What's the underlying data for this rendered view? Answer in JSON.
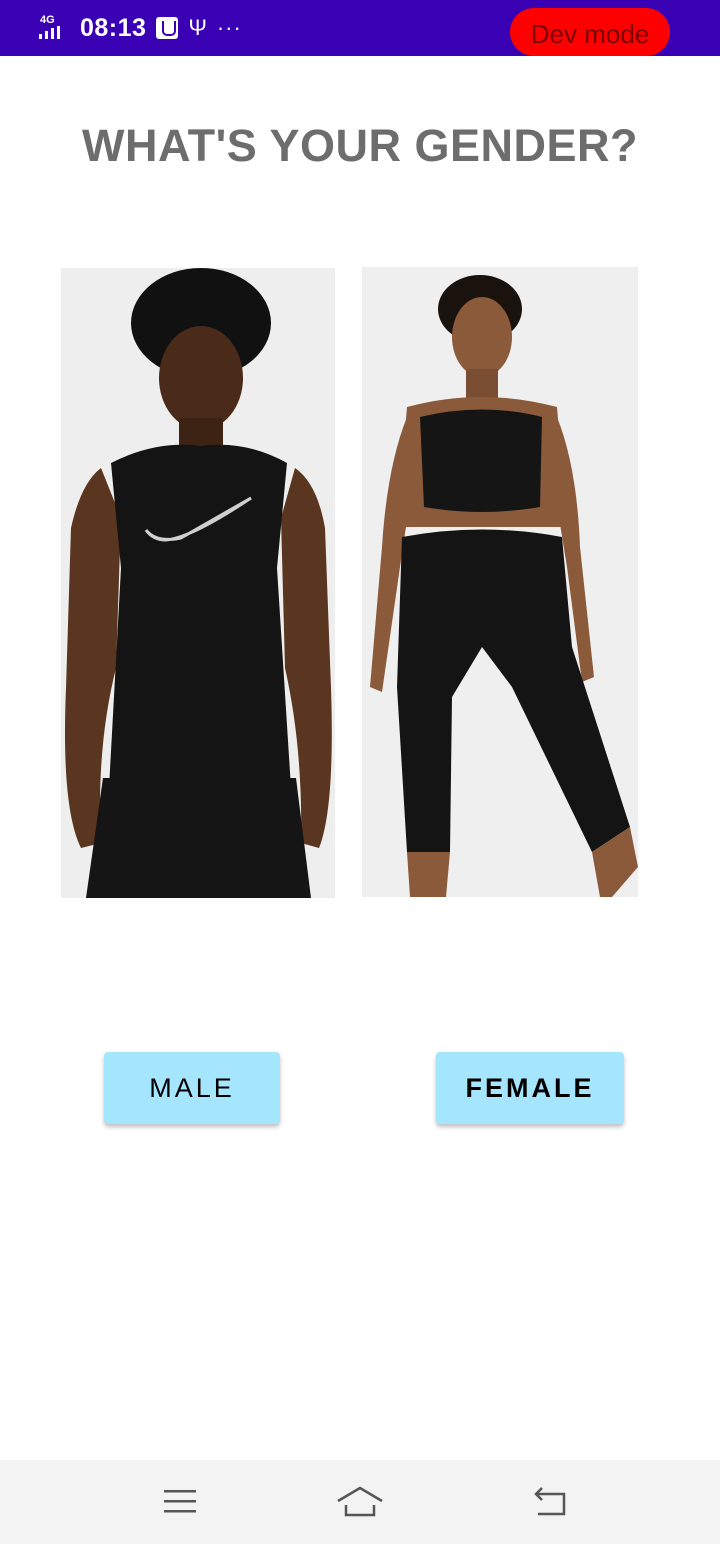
{
  "status_bar": {
    "network": "4G",
    "time": "08:13",
    "more": "···"
  },
  "dev_mode": {
    "label": "Dev mode",
    "color": "#ff0000"
  },
  "page": {
    "title": "WHAT'S YOUR GENDER?",
    "options": [
      {
        "image": "man-in-black-sleeveless-top-photo",
        "label": "MALE"
      },
      {
        "image": "woman-in-black-sports-bra-and-leggings-photo",
        "label": "FEMALE"
      }
    ]
  },
  "colors": {
    "status_bar": "#3a00b4",
    "title": "#6d6d6d",
    "button_background": "#a5e5fd",
    "nav_bar": "#f3f3f3"
  },
  "nav": {
    "menu_icon": "menu-icon",
    "home_icon": "home-icon",
    "back_icon": "back-icon"
  }
}
